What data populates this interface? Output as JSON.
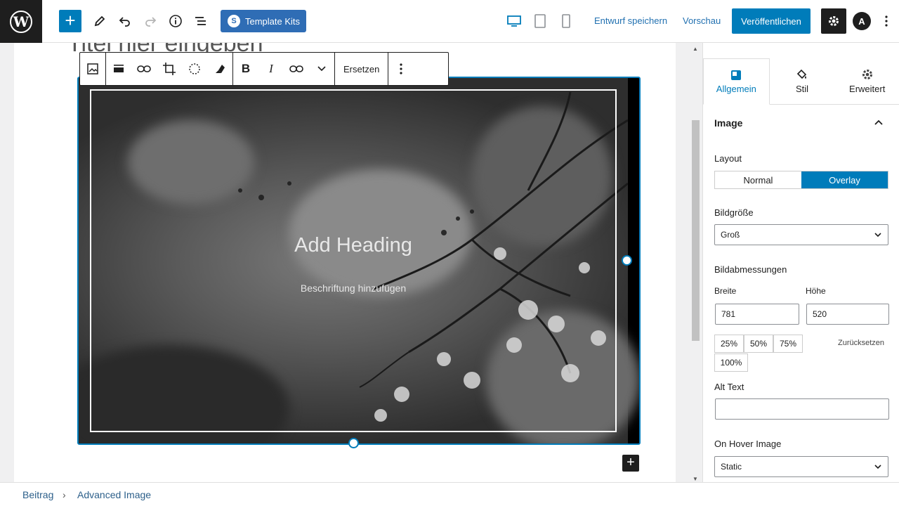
{
  "toolbar": {
    "template_kits_label": "Template Kits",
    "save_draft_label": "Entwurf speichern",
    "preview_label": "Vorschau",
    "publish_label": "Veröffentlichen",
    "accent": "#007cba"
  },
  "editor": {
    "post_title": "Titel hier eingeben",
    "image_heading": "Add Heading",
    "image_caption": "Beschriftung hinzufügen",
    "block_toolbar": {
      "replace_label": "Ersetzen"
    }
  },
  "sidebar": {
    "tabs": [
      {
        "label": "Allgemein",
        "icon": "layout-icon",
        "active": true
      },
      {
        "label": "Stil",
        "icon": "paint-bucket-icon",
        "active": false
      },
      {
        "label": "Erweitert",
        "icon": "gear-icon",
        "active": false
      }
    ],
    "panel_title": "Image",
    "layout_label": "Layout",
    "layout_options": [
      "Normal",
      "Overlay"
    ],
    "layout_selected": "Overlay",
    "image_size_label": "Bildgröße",
    "image_size_value": "Groß",
    "dimensions_label": "Bildabmessungen",
    "width_label": "Breite",
    "height_label": "Höhe",
    "width_value": "781",
    "height_value": "520",
    "percent_options": [
      "25%",
      "50%",
      "75%",
      "100%"
    ],
    "reset_label": "Zurücksetzen",
    "alt_text_label": "Alt Text",
    "alt_text_value": "",
    "hover_label": "On Hover Image",
    "hover_value": "Static"
  },
  "breadcrumb": {
    "items": [
      "Beitrag",
      "Advanced Image"
    ]
  }
}
